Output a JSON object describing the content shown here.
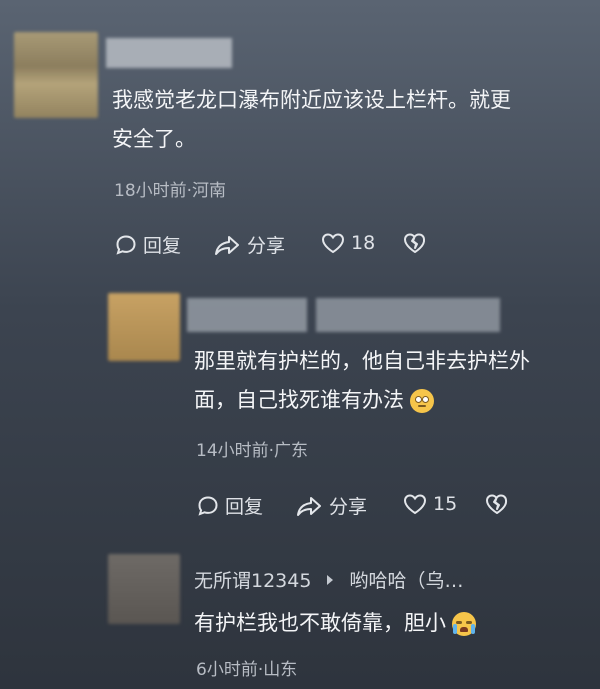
{
  "comments": [
    {
      "text_line1": "我感觉老龙口瀑布附近应该设上栏杆。就更",
      "text_line2": "安全了。",
      "meta": "18小时前·河南",
      "reply_label": "回复",
      "share_label": "分享",
      "like_count": "18"
    },
    {
      "text_line1": "那里就有护栏的，他自己非去护栏外",
      "text_line2": "面，自己找死谁有办法",
      "emoji": "eye-roll-emoji",
      "meta": "14小时前·广东",
      "reply_label": "回复",
      "share_label": "分享",
      "like_count": "15"
    },
    {
      "username": "无所谓12345",
      "reply_to": "哟哈哈（乌…",
      "text": "有护栏我也不敢倚靠，胆小",
      "emoji": "crying-emoji",
      "meta": "6小时前·山东"
    }
  ]
}
